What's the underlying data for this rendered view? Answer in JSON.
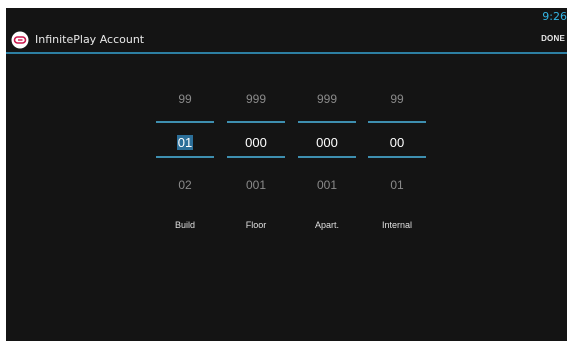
{
  "status_bar": {
    "time": "9:26"
  },
  "action_bar": {
    "logo_icon": "infiniteplay-logo-icon",
    "title": "InfinitePlay Account",
    "done_label": "DONE"
  },
  "colors": {
    "accent": "#33b5e5",
    "divider": "#3e8fb0",
    "background": "#141414"
  },
  "pickers": [
    {
      "label": "Build",
      "prev": "99",
      "value": "01",
      "next": "02"
    },
    {
      "label": "Floor",
      "prev": "999",
      "value": "000",
      "next": "001"
    },
    {
      "label": "Apart.",
      "prev": "999",
      "value": "000",
      "next": "001"
    },
    {
      "label": "Internal",
      "prev": "99",
      "value": "00",
      "next": "01"
    }
  ]
}
